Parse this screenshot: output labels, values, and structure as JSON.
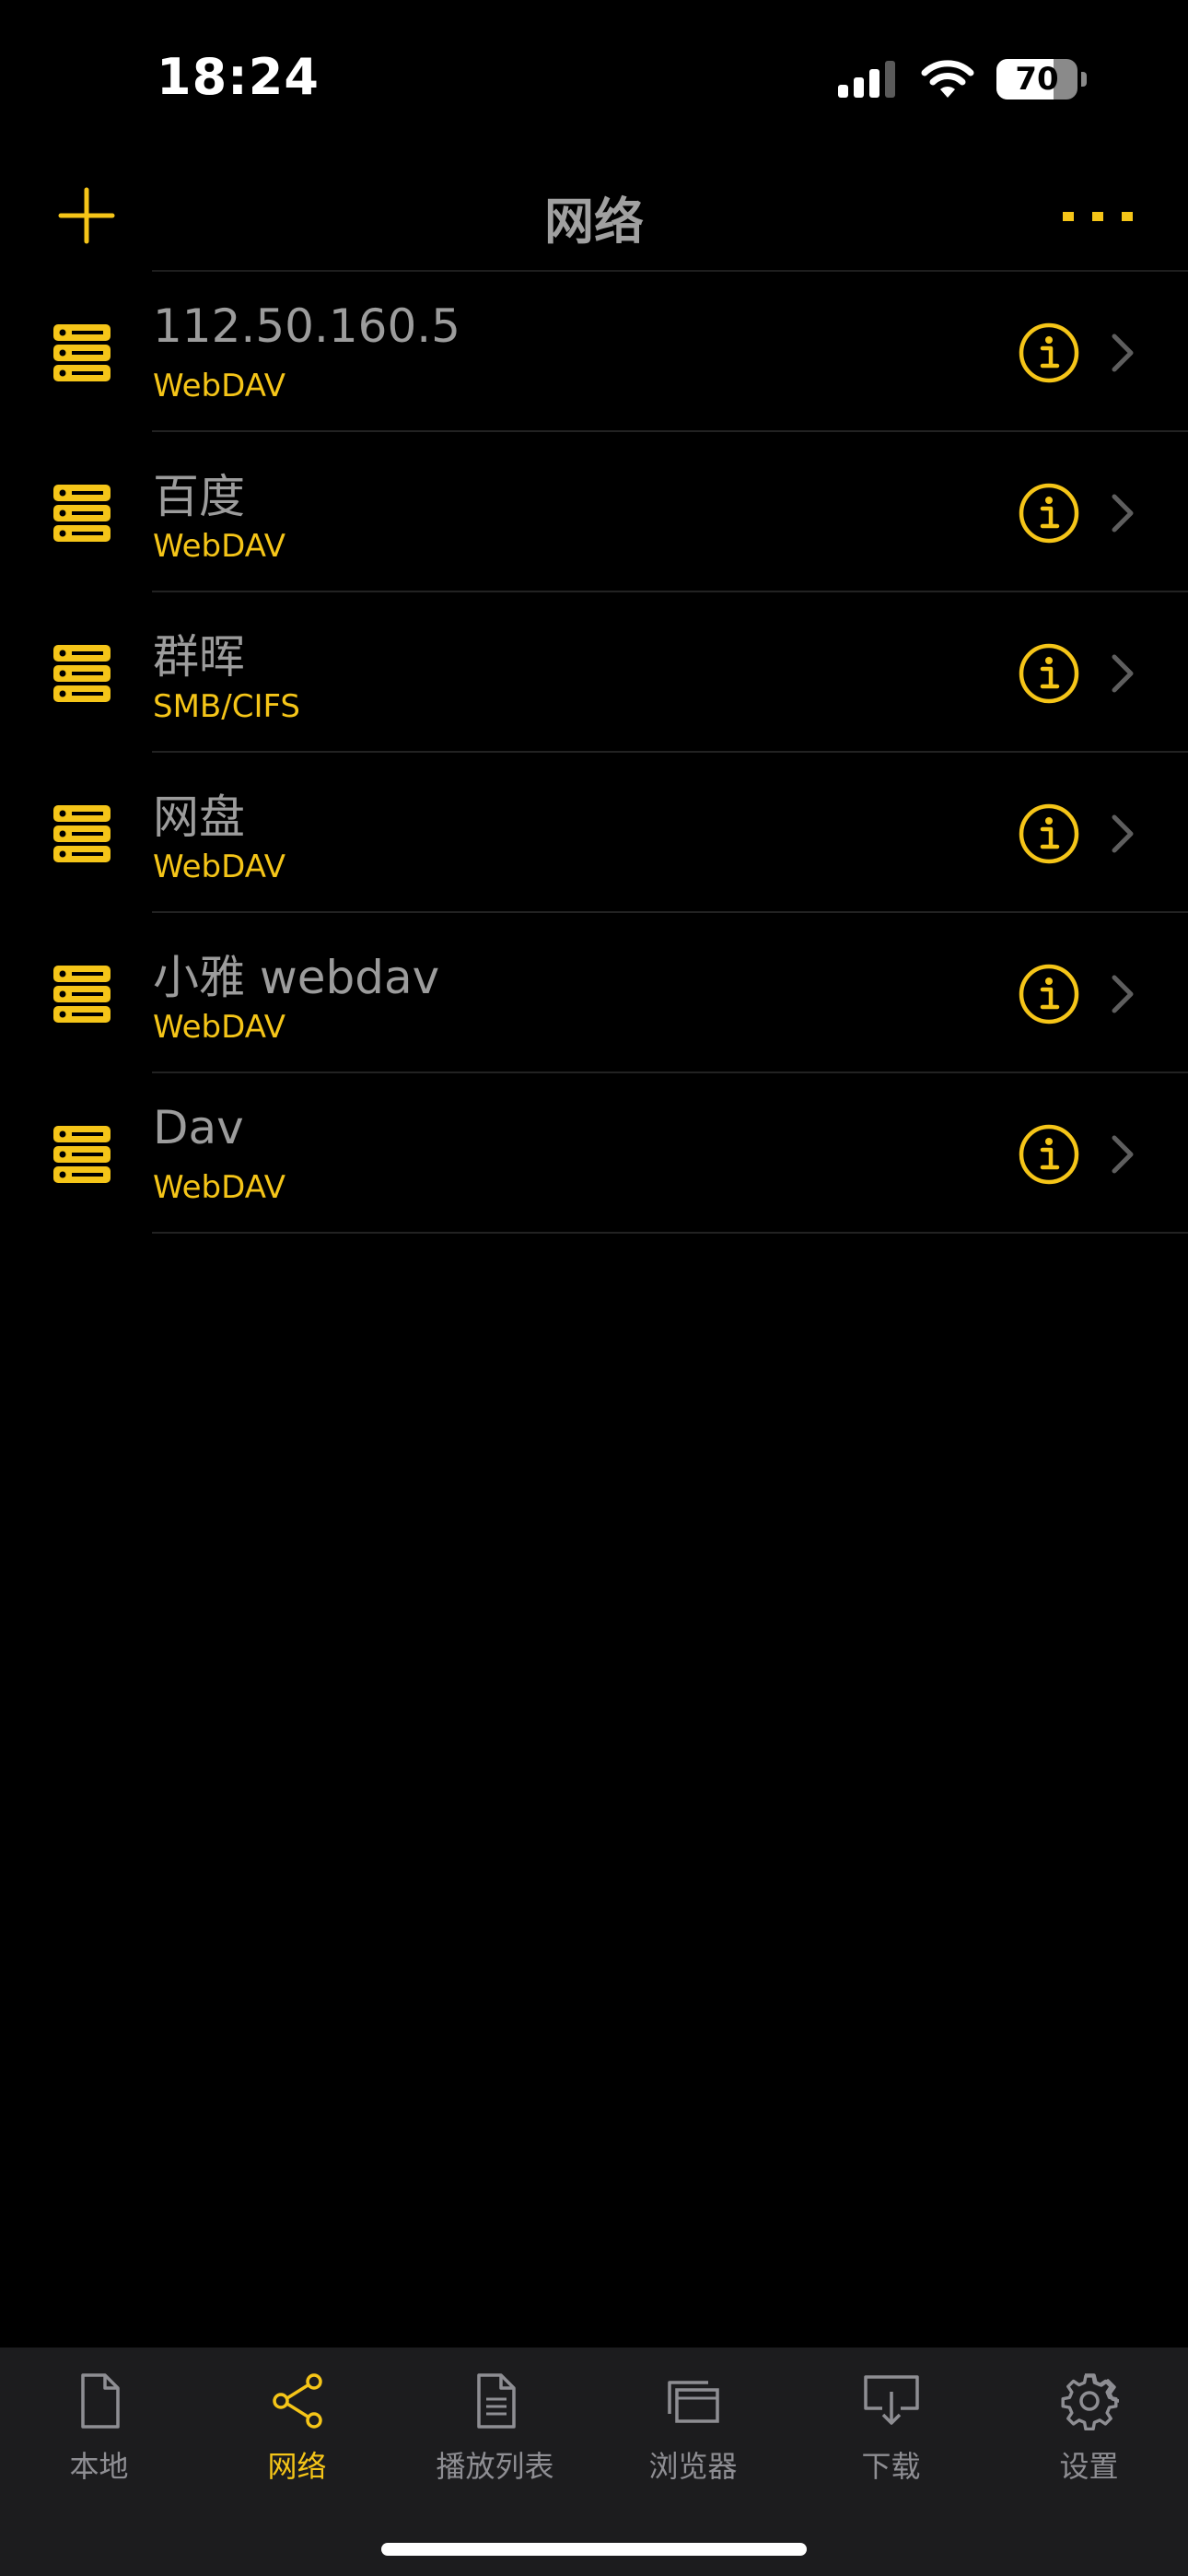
{
  "status_bar": {
    "time": "18:24",
    "battery_percent": 70,
    "battery_label": "70",
    "signal_bars": 3,
    "signal_icon": "cellular-signal-icon",
    "wifi_icon": "wifi-icon"
  },
  "nav": {
    "title": "网络",
    "add_icon": "plus-icon",
    "more_icon": "ellipsis-icon"
  },
  "servers": [
    {
      "name": "112.50.160.5",
      "type": "WebDAV"
    },
    {
      "name": "百度",
      "type": "WebDAV"
    },
    {
      "name": "群晖",
      "type": "SMB/CIFS"
    },
    {
      "name": "网盘",
      "type": "WebDAV"
    },
    {
      "name": "小雅 webdav",
      "type": "WebDAV"
    },
    {
      "name": "Dav",
      "type": "WebDAV"
    }
  ],
  "tabs": [
    {
      "label": "本地",
      "icon": "document-icon",
      "active": false
    },
    {
      "label": "网络",
      "icon": "share-network-icon",
      "active": true
    },
    {
      "label": "播放列表",
      "icon": "playlist-icon",
      "active": false
    },
    {
      "label": "浏览器",
      "icon": "browser-windows-icon",
      "active": false
    },
    {
      "label": "下载",
      "icon": "download-tray-icon",
      "active": false
    },
    {
      "label": "设置",
      "icon": "gear-icon",
      "active": false
    }
  ],
  "colors": {
    "accent": "#f5c518",
    "background": "#000000",
    "tab_bar": "#1c1c1e",
    "inactive_tab": "#8e8e93",
    "primary_text": "#9c9c9c"
  }
}
